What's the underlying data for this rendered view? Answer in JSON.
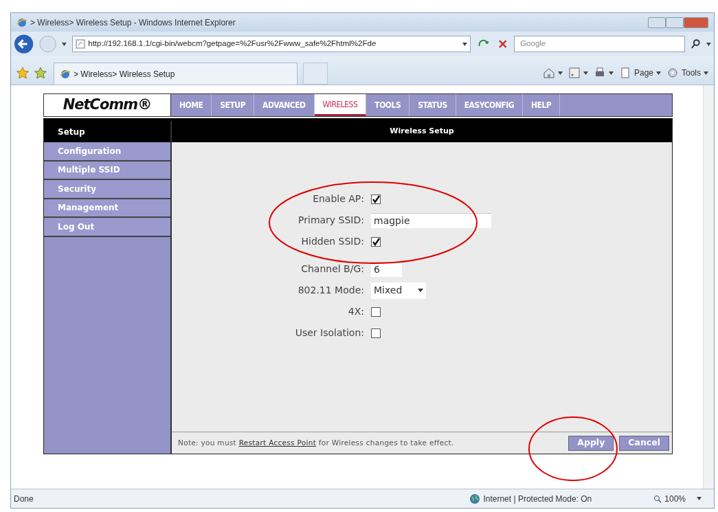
{
  "window": {
    "title": "> Wireless> Wireless Setup - Windows Internet Explorer"
  },
  "address_bar": {
    "value": "http://192.168.1.1/cgi-bin/webcm?getpage=%2Fusr%2Fwww_safe%2Fhtml%2Fde"
  },
  "search": {
    "placeholder": "Google"
  },
  "tab": {
    "title": "> Wireless> Wireless Setup"
  },
  "command_bar": [
    {
      "kind": "home"
    },
    {
      "kind": "feeds"
    },
    {
      "kind": "print"
    },
    {
      "kind": "page",
      "label": "Page"
    },
    {
      "kind": "tools",
      "label": "Tools"
    }
  ],
  "router": {
    "logo": "NetComm®",
    "nav": [
      {
        "label": "HOME",
        "selected": false
      },
      {
        "label": "SETUP",
        "selected": false
      },
      {
        "label": "ADVANCED",
        "selected": false
      },
      {
        "label": "WIRELESS",
        "selected": true
      },
      {
        "label": "TOOLS",
        "selected": false
      },
      {
        "label": "STATUS",
        "selected": false
      },
      {
        "label": "EASYCONFIG",
        "selected": false
      },
      {
        "label": "HELP",
        "selected": false
      }
    ],
    "sidebar": {
      "heading": "Setup",
      "items": [
        {
          "label": "Configuration"
        },
        {
          "label": "Multiple SSID"
        },
        {
          "label": "Security"
        },
        {
          "label": "Management"
        },
        {
          "label": "Log Out"
        }
      ]
    },
    "panel_title": "Wireless Setup",
    "fields": [
      {
        "kind": "checkbox",
        "label": "Enable AP:",
        "checked": true
      },
      {
        "kind": "text",
        "label": "Primary SSID:",
        "value": "magpie"
      },
      {
        "kind": "checkbox",
        "label": "Hidden SSID:",
        "checked": true
      },
      {
        "kind": "text",
        "label": "Channel B/G:",
        "value": "6"
      },
      {
        "kind": "select",
        "label": "802.11 Mode:",
        "value": "Mixed"
      },
      {
        "kind": "checkbox",
        "label": "4X:",
        "checked": false
      },
      {
        "kind": "checkbox",
        "label": "User Isolation:",
        "checked": false
      }
    ],
    "note": {
      "before": "Note: you must ",
      "link": "Restart Access Point",
      "after": " for Wireless changes to take effect."
    },
    "buttons": [
      "Apply",
      "Cancel"
    ]
  },
  "highlights": [
    {
      "kind": "ellipse"
    },
    {
      "kind": "ellipse"
    }
  ],
  "status_bar": {
    "text": "Done",
    "zone": "Internet | Protected Mode: On",
    "zoom": "100%"
  }
}
